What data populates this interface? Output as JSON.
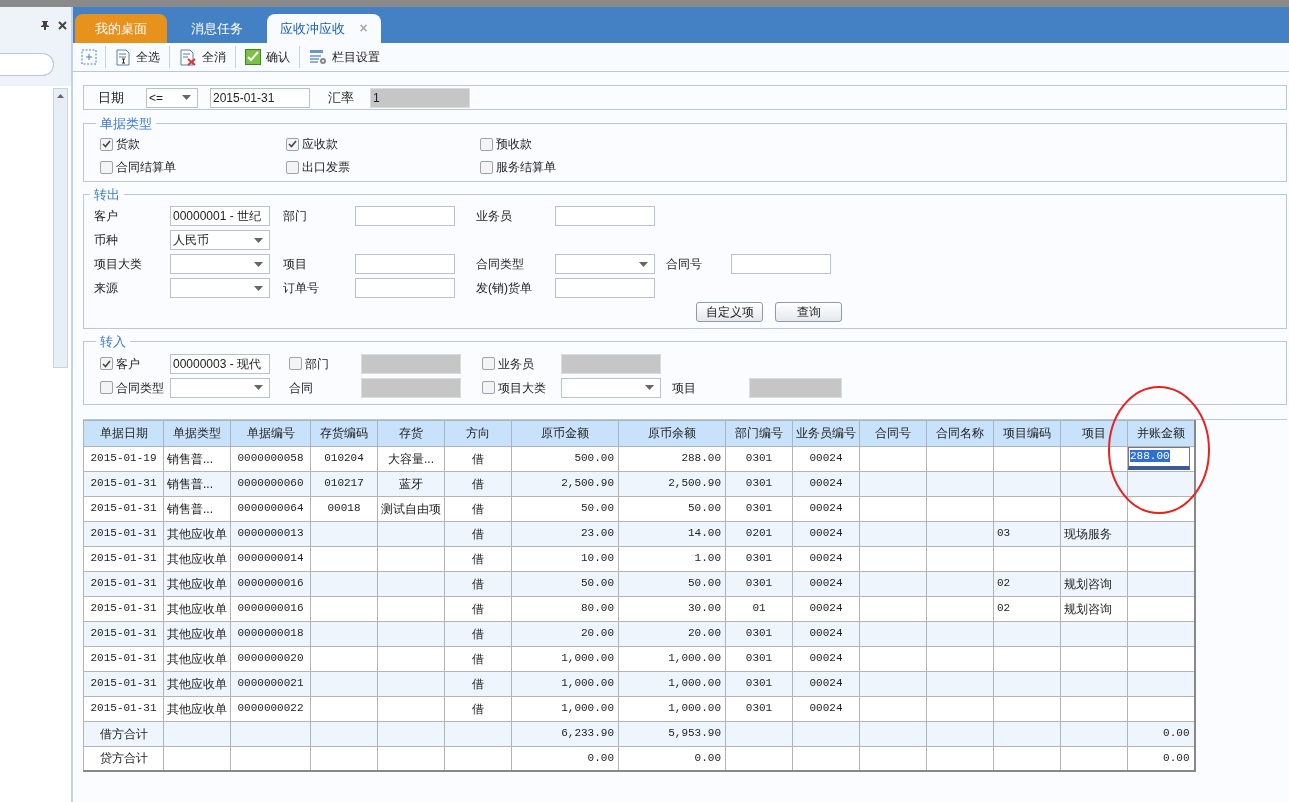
{
  "tabs": [
    {
      "label": "我的桌面",
      "kind": "home",
      "selected": false
    },
    {
      "label": "消息任务",
      "kind": "plain",
      "selected": false
    },
    {
      "label": "应收冲应收",
      "kind": "closable",
      "close": "×",
      "selected": true
    }
  ],
  "toolbar": [
    {
      "kind": "add"
    },
    {
      "kind": "select-all",
      "label": "全选"
    },
    {
      "kind": "clear",
      "label": "全消"
    },
    {
      "kind": "confirm",
      "label": "确认"
    },
    {
      "kind": "columns",
      "label": "栏目设置"
    }
  ],
  "date_row": {
    "date_label": "日期",
    "operator": "<=",
    "date": "2015-01-31",
    "rate_label": "汇率",
    "rate": "1"
  },
  "doc_types": {
    "title": "单据类型",
    "items": [
      {
        "label": "货款",
        "checked": true
      },
      {
        "label": "应收款",
        "checked": true
      },
      {
        "label": "预收款",
        "checked": false
      },
      {
        "label": "合同结算单",
        "checked": false
      },
      {
        "label": "出口发票",
        "checked": false
      },
      {
        "label": "服务结算单",
        "checked": false
      }
    ]
  },
  "transfer_out": {
    "title": "转出",
    "rows": [
      [
        {
          "label": "客户",
          "kind": "text",
          "value": "00000001 - 世纪"
        },
        {
          "label": "部门",
          "kind": "text"
        },
        {
          "label": "业务员",
          "kind": "text"
        }
      ],
      [
        {
          "label": "币种",
          "kind": "select",
          "value": "人民币"
        }
      ],
      [
        {
          "label": "项目大类",
          "kind": "select"
        },
        {
          "label": "项目",
          "kind": "text"
        },
        {
          "label": "合同类型",
          "kind": "select"
        },
        {
          "label": "合同号",
          "kind": "text"
        }
      ],
      [
        {
          "label": "来源",
          "kind": "select"
        },
        {
          "label": "订单号",
          "kind": "text"
        },
        {
          "label": "发(销)货单",
          "kind": "text"
        }
      ]
    ],
    "buttons": [
      "自定义项",
      "查询"
    ]
  },
  "transfer_in": {
    "title": "转入",
    "rows": [
      [
        {
          "label": "客户",
          "checkable": true,
          "checked": true,
          "kind": "text",
          "value": "00000003 - 现代"
        },
        {
          "label": "部门",
          "checkable": true,
          "checked": false,
          "kind": "disabled"
        },
        {
          "label": "业务员",
          "checkable": true,
          "checked": false,
          "kind": "disabled"
        }
      ],
      [
        {
          "label": "合同类型",
          "checkable": true,
          "checked": false,
          "kind": "select"
        },
        {
          "label": "合同",
          "checkable": false,
          "kind": "disabled"
        },
        {
          "label": "项目大类",
          "checkable": true,
          "checked": false,
          "kind": "select"
        },
        {
          "label": "项目",
          "checkable": false,
          "kind": "disabled"
        }
      ]
    ]
  },
  "table": {
    "columns": [
      "单据日期",
      "单据类型",
      "单据编号",
      "存货编码",
      "存货",
      "方向",
      "原币金额",
      "原币余额",
      "部门编号",
      "业务员编号",
      "合同号",
      "合同名称",
      "项目编码",
      "项目",
      "并账金额"
    ],
    "rows": [
      {
        "editing": true,
        "cells": [
          "2015-01-19",
          "销售普...",
          "0000000058",
          "010204",
          "大容量...",
          "借",
          "500.00",
          "288.00",
          "0301",
          "00024",
          null,
          null,
          null,
          null,
          "288.00"
        ]
      },
      {
        "editing": false,
        "cells": [
          "2015-01-31",
          "销售普...",
          "0000000060",
          "010217",
          "蓝牙",
          "借",
          "2,500.90",
          "2,500.90",
          "0301",
          "00024",
          null,
          null,
          null,
          null,
          null
        ]
      },
      {
        "editing": false,
        "cells": [
          "2015-01-31",
          "销售普...",
          "0000000064",
          "00018",
          "测试自由项",
          "借",
          "50.00",
          "50.00",
          "0301",
          "00024",
          null,
          null,
          null,
          null,
          null
        ]
      },
      {
        "editing": false,
        "cells": [
          "2015-01-31",
          "其他应收单",
          "0000000013",
          null,
          null,
          "借",
          "23.00",
          "14.00",
          "0201",
          "00024",
          null,
          null,
          "03",
          "现场服务",
          null
        ]
      },
      {
        "editing": false,
        "cells": [
          "2015-01-31",
          "其他应收单",
          "0000000014",
          null,
          null,
          "借",
          "10.00",
          "1.00",
          "0301",
          "00024",
          null,
          null,
          null,
          null,
          null
        ]
      },
      {
        "editing": false,
        "cells": [
          "2015-01-31",
          "其他应收单",
          "0000000016",
          null,
          null,
          "借",
          "50.00",
          "50.00",
          "0301",
          "00024",
          null,
          null,
          "02",
          "规划咨询",
          null
        ]
      },
      {
        "editing": false,
        "cells": [
          "2015-01-31",
          "其他应收单",
          "0000000016",
          null,
          null,
          "借",
          "80.00",
          "30.00",
          "01",
          "00024",
          null,
          null,
          "02",
          "规划咨询",
          null
        ]
      },
      {
        "editing": false,
        "cells": [
          "2015-01-31",
          "其他应收单",
          "0000000018",
          null,
          null,
          "借",
          "20.00",
          "20.00",
          "0301",
          "00024",
          null,
          null,
          null,
          null,
          null
        ]
      },
      {
        "editing": false,
        "cells": [
          "2015-01-31",
          "其他应收单",
          "0000000020",
          null,
          null,
          "借",
          "1,000.00",
          "1,000.00",
          "0301",
          "00024",
          null,
          null,
          null,
          null,
          null
        ]
      },
      {
        "editing": false,
        "cells": [
          "2015-01-31",
          "其他应收单",
          "0000000021",
          null,
          null,
          "借",
          "1,000.00",
          "1,000.00",
          "0301",
          "00024",
          null,
          null,
          null,
          null,
          null
        ]
      },
      {
        "editing": false,
        "cells": [
          "2015-01-31",
          "其他应收单",
          "0000000022",
          null,
          null,
          "借",
          "1,000.00",
          "1,000.00",
          "0301",
          "00024",
          null,
          null,
          null,
          null,
          null
        ]
      }
    ],
    "totals": [
      {
        "cells": [
          "借方合计",
          null,
          null,
          null,
          null,
          null,
          "6,233.90",
          "5,953.90",
          null,
          null,
          null,
          null,
          null,
          null,
          "0.00"
        ]
      },
      {
        "cells": [
          "贷方合计",
          null,
          null,
          null,
          null,
          null,
          "0.00",
          "0.00",
          null,
          null,
          null,
          null,
          null,
          null,
          "0.00"
        ]
      }
    ]
  },
  "annotation": {
    "kind": "circle"
  }
}
